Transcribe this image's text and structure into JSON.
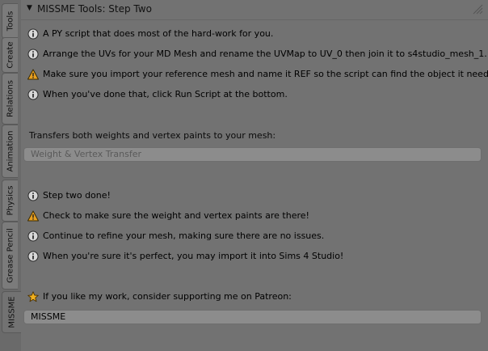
{
  "tabs": [
    {
      "label": "Tools"
    },
    {
      "label": "Create"
    },
    {
      "label": "Relations"
    },
    {
      "label": "Animation"
    },
    {
      "label": "Physics"
    },
    {
      "label": "Grease Pencil"
    },
    {
      "label": "MISSME",
      "active": true
    }
  ],
  "panel": {
    "title": "MISSME Tools: Step Two",
    "section1": [
      {
        "icon": "info-icon",
        "text": "A PY script that does most of the hard-work for you."
      },
      {
        "icon": "info-icon",
        "text": "Arrange the UVs for your MD Mesh and rename the UVMap to UV_0 then join it to s4studio_mesh_1."
      },
      {
        "icon": "warning-icon",
        "text": "Make sure you import your reference mesh and name it REF so the script can find the object it needs."
      },
      {
        "icon": "info-icon",
        "text": "When you've done that, click Run Script at the bottom."
      }
    ],
    "transfer_label": "Transfers both weights and vertex paints to your mesh:",
    "transfer_placeholder": "Weight & Vertex Transfer",
    "section2": [
      {
        "icon": "info-icon",
        "text": "Step two done!"
      },
      {
        "icon": "warning-icon",
        "text": "Check to make sure the weight and vertex paints are there!"
      },
      {
        "icon": "info-icon",
        "text": "Continue to refine your mesh, making sure there are no issues."
      },
      {
        "icon": "info-icon",
        "text": "When you're sure it's perfect, you may import it into Sims 4 Studio!"
      }
    ],
    "support_text": "If you like my work, consider supporting me on Patreon:",
    "support_value": "MISSME"
  }
}
